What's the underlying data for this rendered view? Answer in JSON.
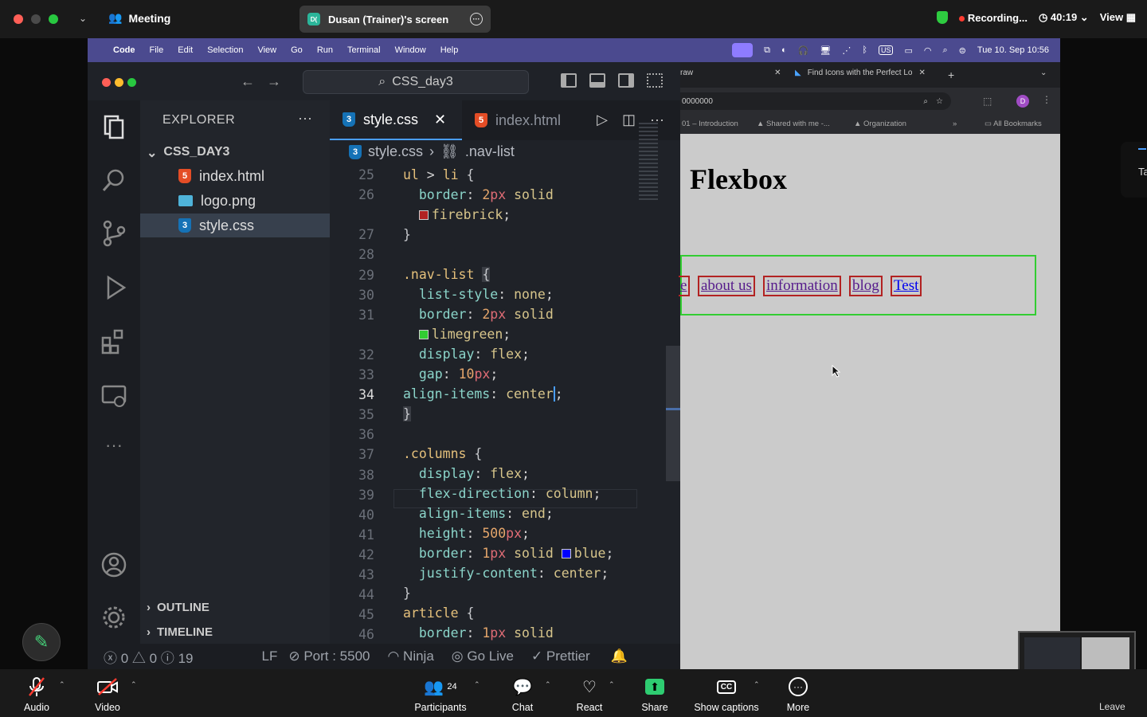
{
  "zoom": {
    "meeting_title": "Meeting",
    "screen_share_label": "Dusan (Trainer)'s screen",
    "screen_badge": "D(",
    "recording_label": "Recording...",
    "timer": "40:19",
    "view_label": "View",
    "bottom": {
      "audio": "Audio",
      "video": "Video",
      "participants": "Participants",
      "participants_count": "24",
      "chat": "Chat",
      "react": "React",
      "share": "Share",
      "captions": "Show captions",
      "more": "More",
      "leave": "Leave"
    },
    "edge_card_text": "Ta"
  },
  "mac_menu": {
    "items": [
      "Code",
      "File",
      "Edit",
      "Selection",
      "View",
      "Go",
      "Run",
      "Terminal",
      "Window",
      "Help"
    ],
    "datetime": "Tue 10. Sep  10:56",
    "input_source": "US"
  },
  "vscode": {
    "search_text": "CSS_day3",
    "explorer_title": "EXPLORER",
    "folder": "CSS_DAY3",
    "files": [
      "index.html",
      "logo.png",
      "style.css"
    ],
    "outline": "OUTLINE",
    "timeline": "TIMELINE",
    "tab_active": "style.css",
    "tab_other": "index.html",
    "breadcrumb_file": "style.css",
    "breadcrumb_symbol": ".nav-list",
    "lines": [
      {
        "n": "25"
      },
      {
        "n": "26"
      },
      {
        "n": ""
      },
      {
        "n": "27"
      },
      {
        "n": "28"
      },
      {
        "n": "29"
      },
      {
        "n": "30"
      },
      {
        "n": "31"
      },
      {
        "n": ""
      },
      {
        "n": "32"
      },
      {
        "n": "33"
      },
      {
        "n": "34"
      },
      {
        "n": "35"
      },
      {
        "n": "36"
      },
      {
        "n": "37"
      },
      {
        "n": "38"
      },
      {
        "n": "39"
      },
      {
        "n": "40"
      },
      {
        "n": "41"
      },
      {
        "n": "42"
      },
      {
        "n": "43"
      },
      {
        "n": "44"
      },
      {
        "n": "45"
      },
      {
        "n": "46"
      }
    ],
    "status": {
      "errors": "0",
      "warnings": "0",
      "info": "19",
      "eol": "LF",
      "port": "Port : 5500",
      "ninja": "Ninja",
      "golive": "Go Live",
      "prettier": "Prettier"
    },
    "colors": {
      "firebrick": "#b22222",
      "limegreen": "#32cd32",
      "blue": "#0000ff"
    }
  },
  "browser": {
    "tab1": "raw",
    "tab2": "Find Icons with the Perfect Lo",
    "url": "0000000",
    "bookmarks": [
      "01 – Introduction",
      "Shared with me -...",
      "Organization",
      "All Bookmarks"
    ],
    "profile_letter": "D",
    "heading": "Flexbox",
    "nav_items": [
      "e",
      "about us",
      "information",
      "blog",
      "Test"
    ]
  }
}
